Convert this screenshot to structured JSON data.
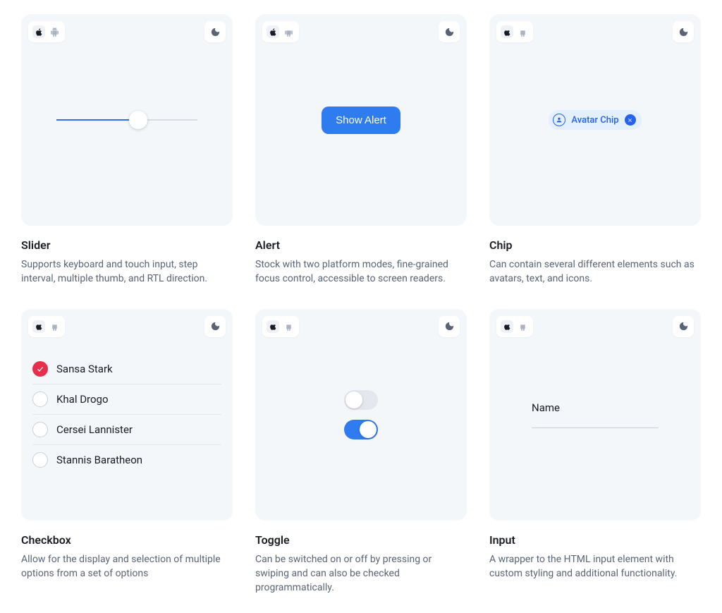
{
  "components": {
    "slider": {
      "title": "Slider",
      "desc": "Supports keyboard and touch input, step interval, multiple thumb, and RTL direction.",
      "value_pct": 58
    },
    "alert": {
      "title": "Alert",
      "desc": "Stock with two platform modes, fine-grained focus control, accessible to screen readers.",
      "button_label": "Show Alert"
    },
    "chip": {
      "title": "Chip",
      "desc": "Can contain several different elements such as avatars, text, and icons.",
      "label": "Avatar Chip"
    },
    "checkbox": {
      "title": "Checkbox",
      "desc": "Allow for the display and selection of multiple options from a set of options",
      "items": [
        {
          "label": "Sansa Stark",
          "checked": true
        },
        {
          "label": "Khal Drogo",
          "checked": false
        },
        {
          "label": "Cersei Lannister",
          "checked": false
        },
        {
          "label": "Stannis Baratheon",
          "checked": false
        }
      ]
    },
    "toggle": {
      "title": "Toggle",
      "desc": "Can be switched on or off by pressing or swiping and can also be checked programmatically.",
      "states": [
        false,
        true
      ]
    },
    "input": {
      "title": "Input",
      "desc": "A wrapper to the HTML input element with custom styling and additional functionality.",
      "label": "Name"
    }
  }
}
